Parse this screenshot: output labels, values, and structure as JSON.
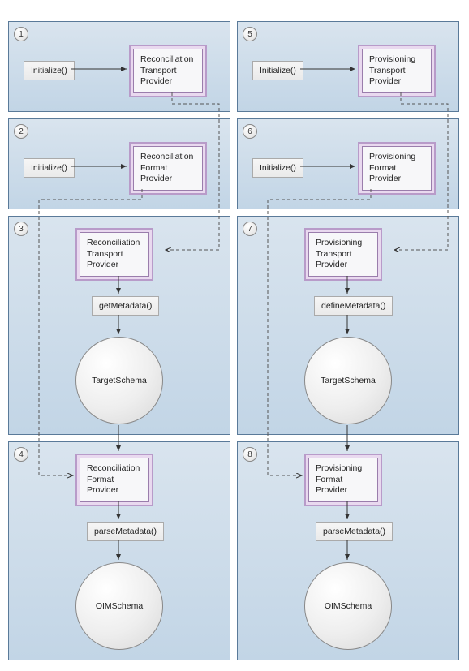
{
  "panels": {
    "p1": {
      "step": "1",
      "initialize": "Initialize()",
      "provider": "Reconciliation\nTransport\nProvider"
    },
    "p2": {
      "step": "2",
      "initialize": "Initialize()",
      "provider": "Reconciliation\nFormat\nProvider"
    },
    "p3": {
      "step": "3",
      "provider": "Reconciliation\nTransport\nProvider",
      "method": "getMetadata()",
      "schema": "TargetSchema"
    },
    "p4": {
      "step": "4",
      "provider": "Reconciliation\nFormat\nProvider",
      "method": "parseMetadata()",
      "schema": "OIMSchema"
    },
    "p5": {
      "step": "5",
      "initialize": "Initialize()",
      "provider": "Provisioning\nTransport\nProvider"
    },
    "p6": {
      "step": "6",
      "initialize": "Initialize()",
      "provider": "Provisioning\nFormat\nProvider"
    },
    "p7": {
      "step": "7",
      "provider": "Provisioning\nTransport\nProvider",
      "method": "defineMetadata()",
      "schema": "TargetSchema"
    },
    "p8": {
      "step": "8",
      "provider": "Provisioning\nFormat\nProvider",
      "method": "parseMetadata()",
      "schema": "OIMSchema"
    }
  }
}
